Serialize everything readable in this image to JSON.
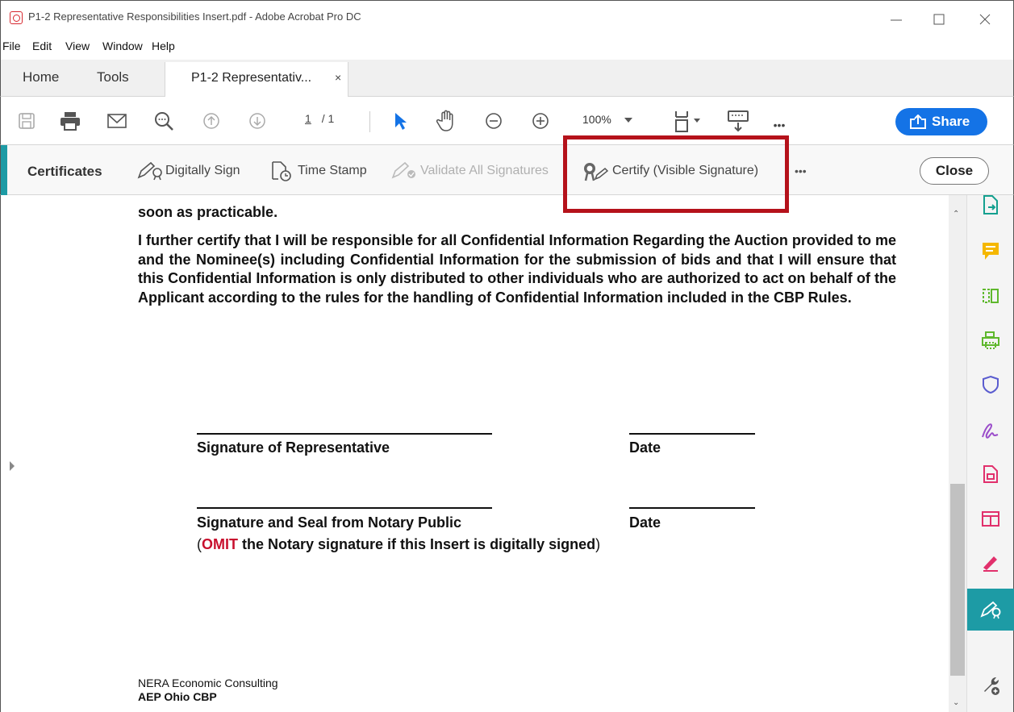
{
  "window": {
    "title": "P1-2 Representative Responsibilities Insert.pdf - Adobe Acrobat Pro DC"
  },
  "menu": [
    "File",
    "Edit",
    "View",
    "Window",
    "Help"
  ],
  "tabs": {
    "home": "Home",
    "tools": "Tools",
    "document": "P1-2 Representativ...",
    "close_glyph": "×"
  },
  "toolbar": {
    "page_current": "1",
    "page_total": "/ 1",
    "zoom": "100%",
    "share_label": "Share",
    "more_glyph": "•••"
  },
  "certificates": {
    "heading": "Certificates",
    "items": [
      {
        "label": "Digitally Sign",
        "enabled": true
      },
      {
        "label": "Time Stamp",
        "enabled": true
      },
      {
        "label": "Validate All Signatures",
        "enabled": false
      },
      {
        "label": "Certify (Visible Signature)",
        "enabled": true
      }
    ],
    "more_glyph": "•••",
    "close_label": "Close"
  },
  "highlight_color": "#b5121b",
  "accent_color": "#1d9ba5",
  "document": {
    "partial_line": "soon as practicable.",
    "paragraph": "I further certify that I will be responsible for all Confidential Information Regarding the Auction provided to me and the Nominee(s) including Confidential Information for the submission of bids and that I will ensure that this Confidential Information is only distributed to other individuals who are authorized to act on behalf of the Applicant according to the rules for the handling of Confidential Information included in the CBP Rules.",
    "sig1_label": "Signature of Representative",
    "date1_label": "Date",
    "sig2_label": "Signature and Seal from Notary Public",
    "date2_label": "Date",
    "omit_open": "(",
    "omit_word": "OMIT",
    "omit_rest": " the Notary signature if this Insert is digitally signed",
    "omit_close": ")",
    "footer_company": "NERA Economic Consulting",
    "footer_project": "AEP Ohio CBP"
  },
  "right_panel_icons": [
    "export-pdf-icon",
    "comment-icon",
    "organize-pages-icon",
    "print-production-icon",
    "protect-icon",
    "fill-sign-icon",
    "create-pdf-icon",
    "compare-icon",
    "request-signature-icon",
    "certificates-icon",
    "more-tools-icon"
  ]
}
